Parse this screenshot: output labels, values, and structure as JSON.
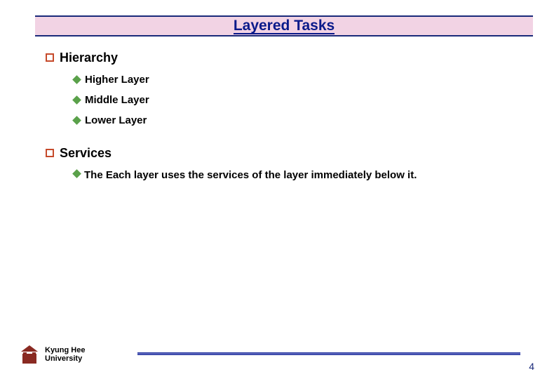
{
  "title": "Layered Tasks",
  "sections": [
    {
      "marker": "square",
      "heading": "Hierarchy",
      "items": [
        {
          "marker": "diamond",
          "text": "Higher Layer"
        },
        {
          "marker": "diamond",
          "text": "Middle Layer"
        },
        {
          "marker": "diamond",
          "text": "Lower Layer"
        }
      ]
    },
    {
      "marker": "square",
      "heading": "Services",
      "items": [
        {
          "marker": "diamond",
          "text": "The Each layer uses the services of the layer immediately below it."
        }
      ]
    }
  ],
  "footer": {
    "university_line1": "Kyung Hee",
    "university_line2": "University",
    "logo": "kyunghee-crest-icon"
  },
  "page_number": "4",
  "colors": {
    "title_band_bg": "#f2d3e4",
    "title_band_border": "#1a2a7a",
    "title_text": "#0a1a8a",
    "square_bullet_border": "#c64a2b",
    "diamond_bullet_fill": "#5aa14a",
    "footer_bar": "#2a3aa0",
    "page_number_color": "#1a2a7a",
    "logo_color": "#8a2a22"
  }
}
